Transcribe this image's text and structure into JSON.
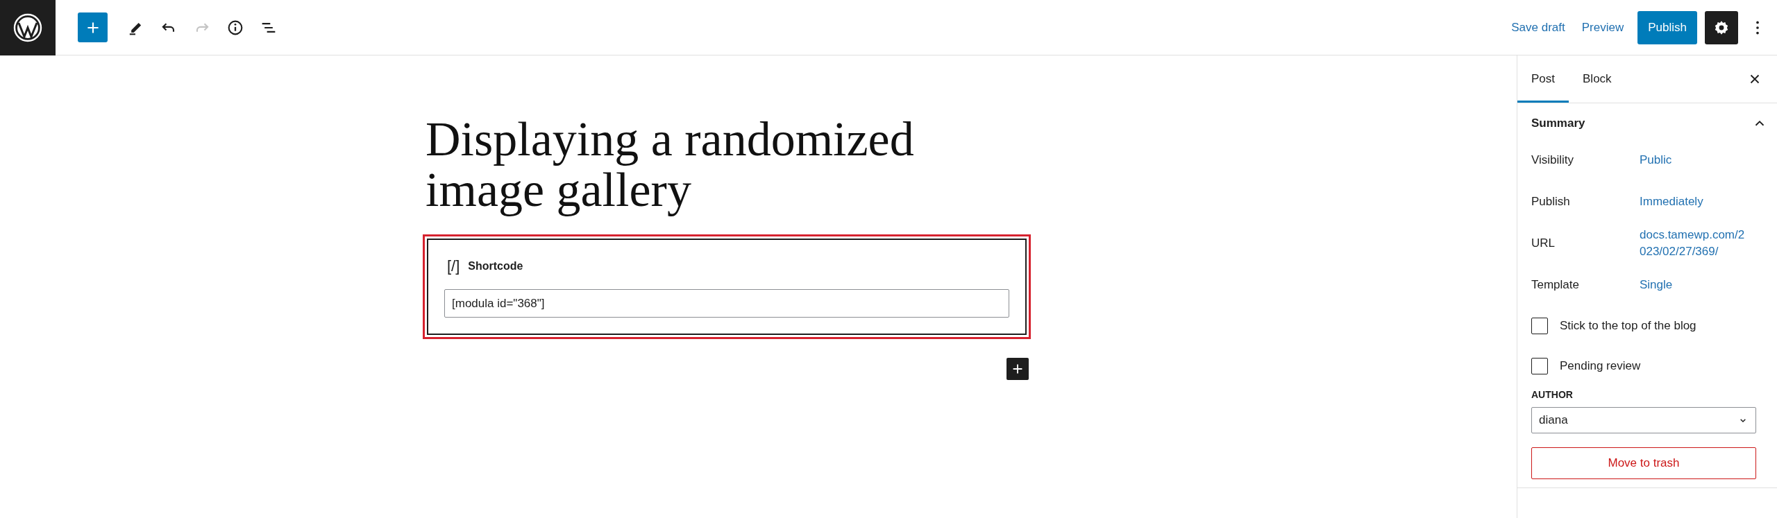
{
  "toolbar": {
    "tools": [
      {
        "kind": "add",
        "disabled": false
      },
      {
        "kind": "edit",
        "disabled": false
      },
      {
        "kind": "undo",
        "disabled": false
      },
      {
        "kind": "redo",
        "disabled": true
      },
      {
        "kind": "info",
        "disabled": false
      },
      {
        "kind": "outline",
        "disabled": false
      }
    ],
    "save_draft": "Save draft",
    "preview": "Preview",
    "publish": "Publish",
    "settings": {
      "selected": true
    }
  },
  "editor": {
    "title": "Displaying a randomized image gallery",
    "block": {
      "label": "Shortcode",
      "icon": "[/]",
      "value": "[modula id=\"368\"]",
      "selected": true,
      "highlighted": true
    }
  },
  "sidebar": {
    "tabs": [
      {
        "label": "Post",
        "selected": true
      },
      {
        "label": "Block",
        "selected": false
      }
    ],
    "panel": {
      "title": "Summary",
      "expanded": true,
      "rows": [
        {
          "label": "Visibility",
          "value": "Public"
        },
        {
          "label": "Publish",
          "value": "Immediately"
        },
        {
          "label": "URL",
          "value": "docs.tamewp.com/2023/02/27/369/"
        },
        {
          "label": "Template",
          "value": "Single"
        }
      ],
      "checkboxes": [
        {
          "label": "Stick to the top of the blog",
          "checked": false
        },
        {
          "label": "Pending review",
          "checked": false
        }
      ],
      "author": {
        "label": "AUTHOR",
        "value": "diana"
      },
      "trash": "Move to trash"
    }
  }
}
